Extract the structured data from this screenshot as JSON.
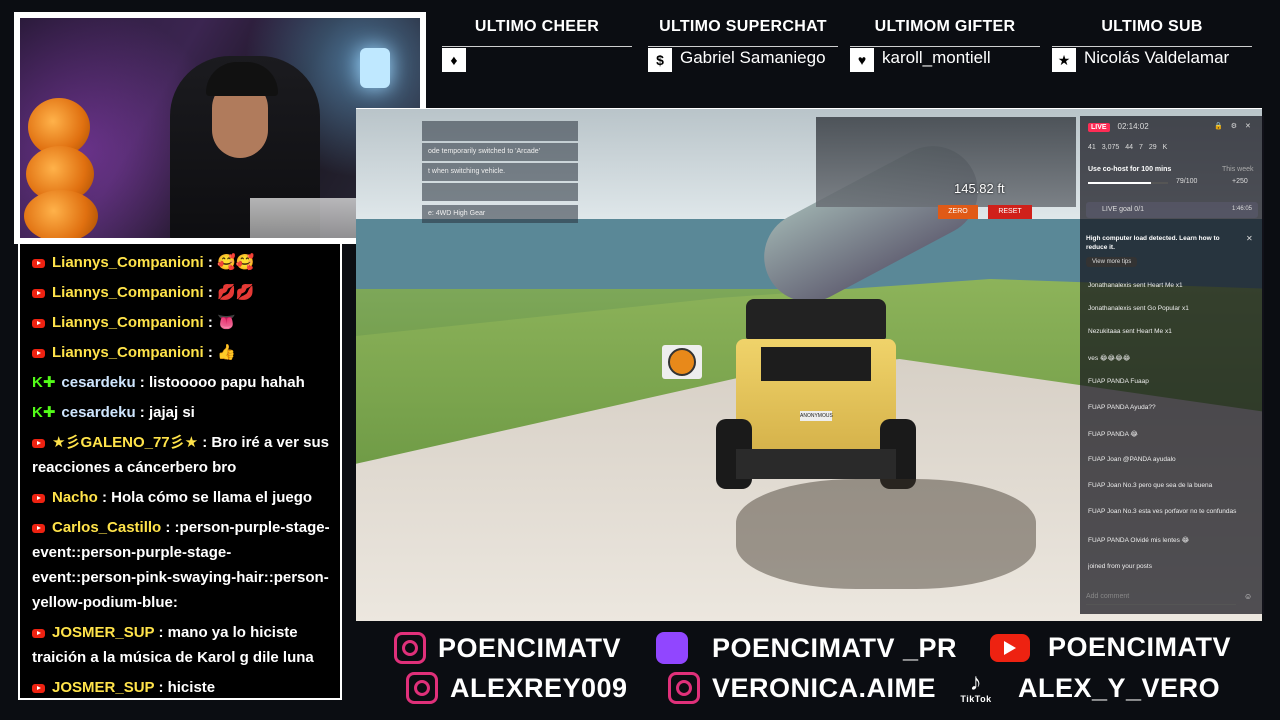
{
  "alerts": [
    {
      "title": "ULTIMO CHEER",
      "icon": "diamond-icon",
      "glyph": "♦",
      "name": ""
    },
    {
      "title": "ULTIMO SUPERCHAT",
      "icon": "dollar-icon",
      "glyph": "$",
      "name": "Gabriel Samaniego"
    },
    {
      "title": "ULTIMOM GIFTER",
      "icon": "heart-icon",
      "glyph": "♥",
      "name": "karoll_montiell"
    },
    {
      "title": "ULTIMO SUB",
      "icon": "star-icon",
      "glyph": "★",
      "name": "Nicolás Valdelamar"
    }
  ],
  "chat": [
    {
      "platform": "youtube",
      "user": "Liannys_Companioni",
      "text": ": 🥰🥰"
    },
    {
      "platform": "youtube",
      "user": "Liannys_Companioni",
      "text": ": 💋💋"
    },
    {
      "platform": "youtube",
      "user": "Liannys_Companioni",
      "text": ": 👅"
    },
    {
      "platform": "youtube",
      "user": "Liannys_Companioni",
      "text": ": 👍"
    },
    {
      "platform": "kick",
      "user": "cesardeku",
      "text": ": listooooo papu hahah"
    },
    {
      "platform": "kick",
      "user": "cesardeku",
      "text": ": jajaj si"
    },
    {
      "platform": "youtube",
      "user": "★彡GALENO_77彡★",
      "text": ": Bro iré a ver sus reacciones a cáncerbero bro"
    },
    {
      "platform": "youtube",
      "user": "Nacho",
      "text": ": Hola cómo se llama el juego"
    },
    {
      "platform": "youtube",
      "user": "Carlos_Castillo",
      "text": ": :person-purple-stage-event::person-purple-stage-event::person-pink-swaying-hair::person-yellow-podium-blue:"
    },
    {
      "platform": "youtube",
      "user": "JOSMER_SUP",
      "text": ": mano ya lo hiciste traición a la música de Karol g dile luna"
    },
    {
      "platform": "youtube",
      "user": "JOSMER_SUP",
      "text": ": hiciste"
    }
  ],
  "game": {
    "hud_lines": [
      "ode temporarily switched to 'Arcade'",
      "t when switching vehicle.",
      "e: 4WD High Gear"
    ],
    "distance": "145.82 ft",
    "zero_label": "ZERO",
    "reset_label": "RESET",
    "plate": "ANONYMOUS"
  },
  "tiktok": {
    "live_badge": "LIVE",
    "timer": "02:14:02",
    "stats": [
      "41",
      "3,075",
      "44",
      "7",
      "29 K"
    ],
    "cohost_text": "Use co-host for 100 mins",
    "cohost_progress": "79/100",
    "this_week": "This week",
    "points": "+250",
    "goal_text": "LIVE goal 0/1",
    "goal_time": "1:46:05",
    "tip_text": "High computer load detected. Learn how to reduce it.",
    "tip_link": "View more tips",
    "messages": [
      "Jonathanalexis sent Heart Me x1",
      "Jonathanalexis sent Go Popular x1",
      "Nezukitaaa sent Heart Me x1",
      "ves 😂😂😂😂",
      "FUAP PANDA Fuaap",
      "FUAP PANDA Ayuda??",
      "FUAP PANDA 😂",
      "FUAP Joan @PANDA ayudalo",
      "FUAP Joan No.3 pero que sea de la buena",
      "FUAP Joan No.3 esta ves porfavor no te confundas",
      "FUAP PANDA Olvidé mis lentes 😂",
      "joined from your posts"
    ],
    "comment_placeholder": "Add comment"
  },
  "socials": [
    {
      "icon": "instagram-icon",
      "handle": "POENCIMATV"
    },
    {
      "icon": "twitch-icon",
      "handle": "POENCIMATV _PR"
    },
    {
      "icon": "youtube-icon",
      "handle": "POENCIMATV"
    },
    {
      "icon": "instagram-icon",
      "handle": "ALEXREY009"
    },
    {
      "icon": "instagram-icon",
      "handle": "VERONICA.AIME"
    },
    {
      "icon": "tiktok-icon",
      "handle": "ALEX_Y_VERO",
      "brand": "TikTok"
    }
  ]
}
